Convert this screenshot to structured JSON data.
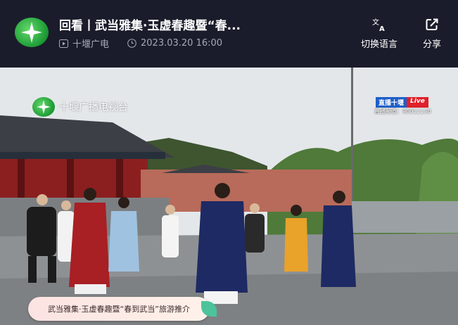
{
  "header": {
    "title": "回看丨武当雅集·玉虚春趣暨“春...",
    "source": "十堰广电",
    "datetime": "2023.03.20 16:00",
    "switch_language_label": "切换语言",
    "share_label": "分享"
  },
  "video": {
    "watermark": "十堰广播电视台",
    "live_badge_cn": "直播十堰",
    "live_badge_en": "Live",
    "live_id": "直播频道：90011130",
    "caption": "武当雅集·玉虚春趣暨“春到武当”旅游推介"
  },
  "colors": {
    "header_bg": "#1b1c2b",
    "brand_green": "#1c9a34",
    "live_red": "#e0202a",
    "live_blue": "#1e5fc8"
  }
}
